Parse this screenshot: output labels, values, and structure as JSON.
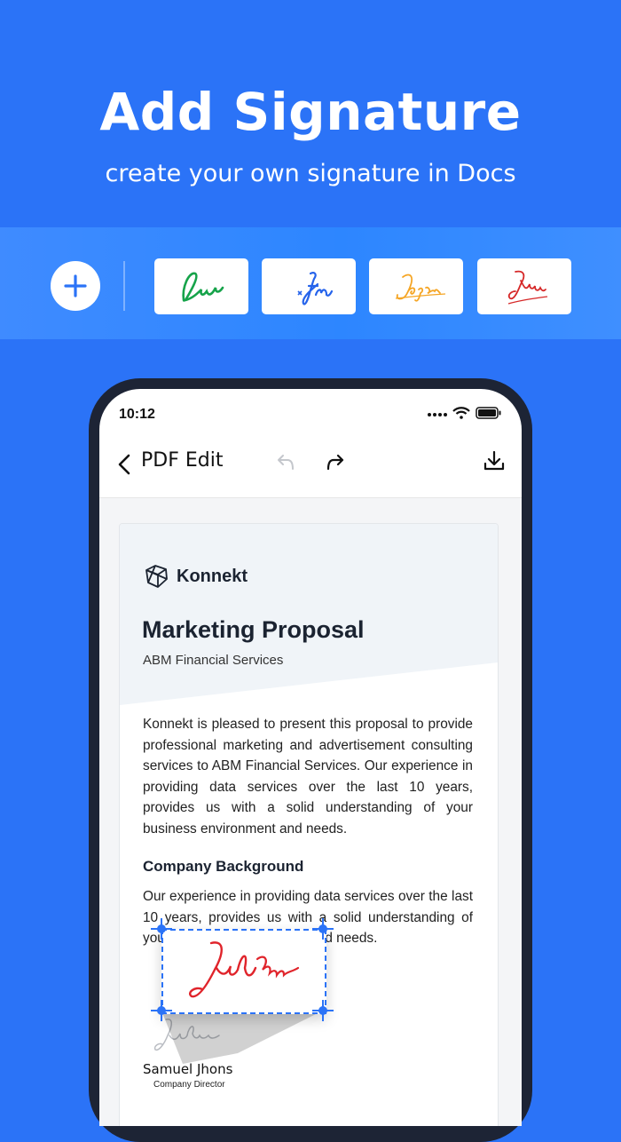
{
  "hero": {
    "title": "Add Signature",
    "subtitle": "create your own signature in Docs"
  },
  "signature_strip": {
    "add_icon": "plus-icon",
    "signatures": [
      {
        "name": "signature-green",
        "color": "#16a34a"
      },
      {
        "name": "signature-blue",
        "color": "#2563eb"
      },
      {
        "name": "signature-orange",
        "color": "#f5a524"
      },
      {
        "name": "signature-red",
        "color": "#d62828"
      }
    ]
  },
  "status_bar": {
    "time": "10:12"
  },
  "app_bar": {
    "title": "PDF Edit",
    "back_icon": "chevron-left-icon",
    "undo_icon": "undo-icon",
    "redo_icon": "redo-icon",
    "download_icon": "download-icon"
  },
  "document": {
    "brand": "Konnekt",
    "title": "Marketing Proposal",
    "subtitle": "ABM Financial Services",
    "paragraph": "Konnekt is pleased to present this proposal to provide professional marketing and advertisement consulting services to ABM Financial Services. Our experience in providing data services over the last 10 years, provides us with a solid understanding of your business environment and needs.",
    "section_title": "Company Background",
    "section_paragraph": "Our experience in providing data services over the last 10 years, provides us with a solid understanding of your business environment and needs.",
    "signer_name": "Samuel Jhons",
    "signer_role": "Company Director"
  },
  "colors": {
    "background": "#2b73f7",
    "accent": "#2b73f7",
    "signature_red": "#e0242b"
  }
}
